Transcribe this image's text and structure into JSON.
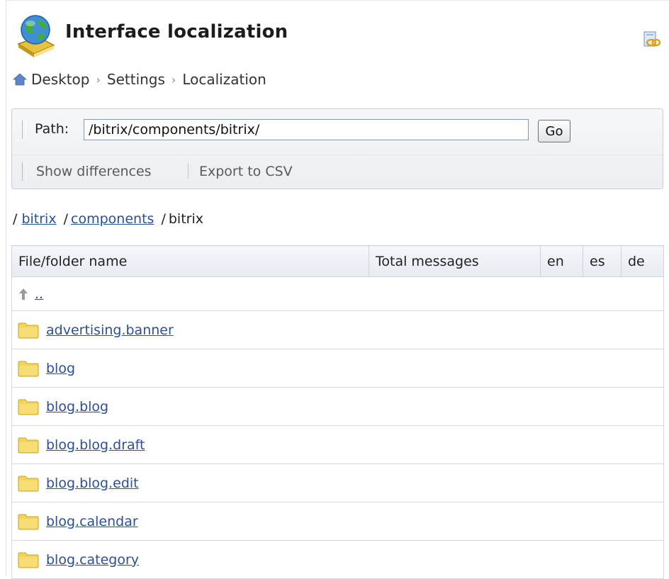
{
  "header": {
    "title": "Interface localization",
    "app_icon": "globe-book-icon",
    "link_icon": "link-icon"
  },
  "breadcrumb": {
    "home_icon": "home-icon",
    "items": [
      "Desktop",
      "Settings",
      "Localization"
    ],
    "separator": "›"
  },
  "toolbar": {
    "path_label": "Path:",
    "path_value": "/bitrix/components/bitrix/",
    "go_label": "Go",
    "show_differences": "Show differences",
    "export_csv": "Export to CSV"
  },
  "path_crumbs": {
    "root": "/",
    "links": [
      "bitrix",
      "components"
    ],
    "current": "bitrix"
  },
  "table": {
    "columns": [
      "File/folder name",
      "Total messages",
      "en",
      "es",
      "de"
    ],
    "up_label": "..",
    "rows": [
      {
        "name": "advertising.banner",
        "total": "",
        "en": "",
        "es": "",
        "de": ""
      },
      {
        "name": "blog",
        "total": "",
        "en": "",
        "es": "",
        "de": ""
      },
      {
        "name": "blog.blog",
        "total": "",
        "en": "",
        "es": "",
        "de": ""
      },
      {
        "name": "blog.blog.draft",
        "total": "",
        "en": "",
        "es": "",
        "de": ""
      },
      {
        "name": "blog.blog.edit",
        "total": "",
        "en": "",
        "es": "",
        "de": ""
      },
      {
        "name": "blog.calendar",
        "total": "",
        "en": "",
        "es": "",
        "de": ""
      },
      {
        "name": "blog.category",
        "total": "",
        "en": "",
        "es": "",
        "de": ""
      }
    ]
  },
  "colors": {
    "link": "#2a4f9e",
    "folder": "#f3d35a",
    "header_bg": "#e9edf3"
  }
}
